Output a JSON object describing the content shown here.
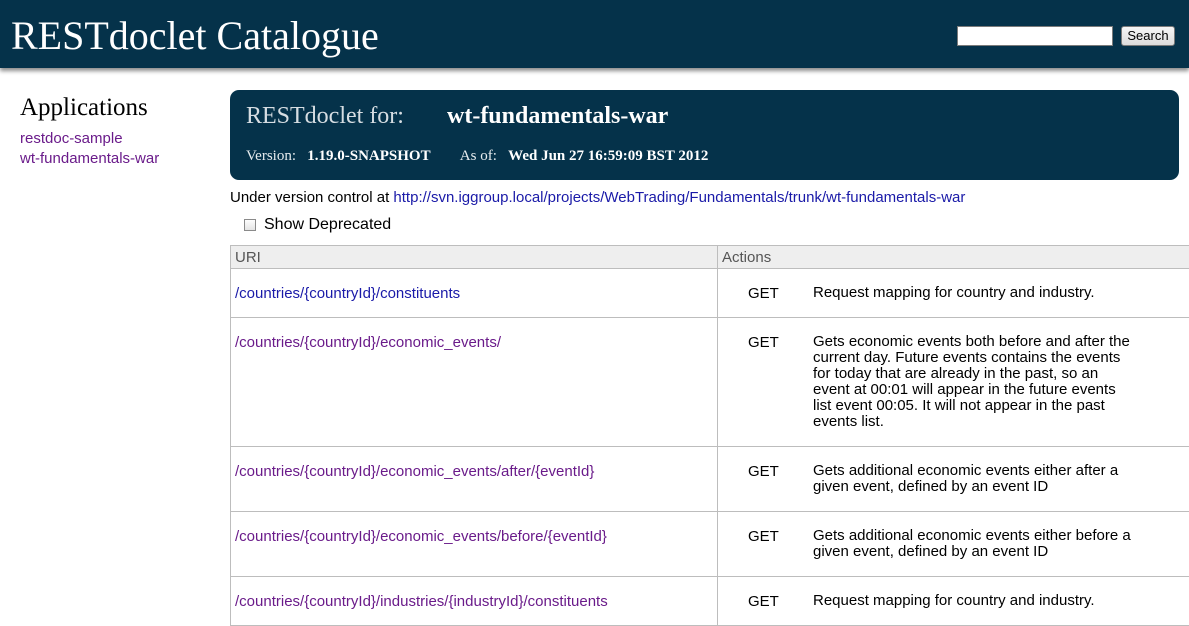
{
  "header": {
    "title": "RESTdoclet Catalogue",
    "search_placeholder": "",
    "search_button": "Search"
  },
  "sidebar": {
    "heading": "Applications",
    "items": [
      "restdoc-sample",
      "wt-fundamentals-war"
    ]
  },
  "banner": {
    "for_label": "RESTdoclet for:",
    "app_name": "wt-fundamentals-war",
    "version_label": "Version:",
    "version": "1.19.0-SNAPSHOT",
    "as_of_label": "As of:",
    "as_of": "Wed Jun 27 16:59:09 BST 2012"
  },
  "version_control": {
    "prefix": "Under version control at",
    "url": "http://svn.iggroup.local/projects/WebTrading/Fundamentals/trunk/wt-fundamentals-war"
  },
  "show_deprecated_label": "Show Deprecated",
  "table": {
    "headers": [
      "URI",
      "Actions"
    ],
    "rows": [
      {
        "uri": "/countries/{countryId}/constituents",
        "method": "GET",
        "description": "Request mapping for country and industry."
      },
      {
        "uri": "/countries/{countryId}/economic_events/",
        "method": "GET",
        "description": "Gets economic events both before and after the current day. Future events contains the events for today that are already in the past, so an event at 00:01 will appear in the future events list event 00:05. It will not appear in the past events list."
      },
      {
        "uri": "/countries/{countryId}/economic_events/after/{eventId}",
        "method": "GET",
        "description": "Gets additional economic events either after a given event, defined by an event ID"
      },
      {
        "uri": "/countries/{countryId}/economic_events/before/{eventId}",
        "method": "GET",
        "description": "Gets additional economic events either before a given event, defined by an event ID"
      },
      {
        "uri": "/countries/{countryId}/industries/{industryId}/constituents",
        "method": "GET",
        "description": "Request mapping for country and industry."
      }
    ]
  }
}
